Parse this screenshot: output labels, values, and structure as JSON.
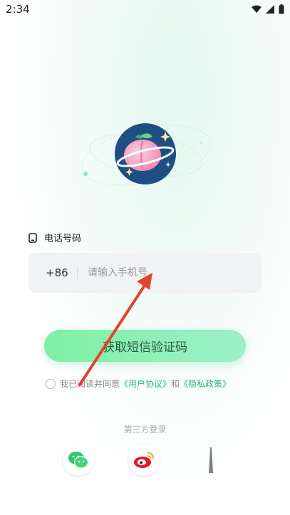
{
  "status_bar": {
    "time": "2:34"
  },
  "login": {
    "phone_label": "电话号码",
    "country_code": "+86",
    "phone_placeholder": "请输入手机号",
    "sms_button": "获取短信验证码",
    "agree_prefix": "我已阅读并同意",
    "user_agreement": "《用户协议》",
    "and": "和",
    "privacy_policy": "《隐私政策》",
    "third_party_title": "第三方登录"
  },
  "colors": {
    "accent": "#2fb97a",
    "button_start": "#7ff0a4",
    "button_end": "#9cf0c8",
    "annotation_arrow": "#e2432c"
  },
  "icons": [
    "wifi-icon",
    "signal-icon",
    "battery-icon",
    "phone-icon",
    "wechat-icon",
    "weibo-icon",
    "third-login-icon"
  ]
}
